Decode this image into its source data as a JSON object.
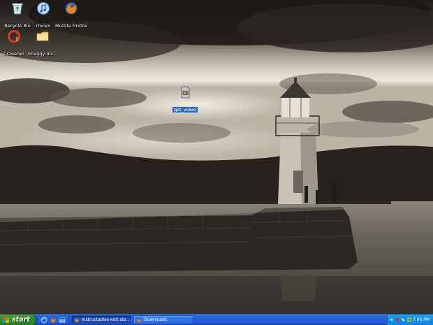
{
  "desktop": {
    "icons": [
      {
        "label": "Recycle Bin"
      },
      {
        "label": "iTunes"
      },
      {
        "label": "Mozilla Firefox"
      },
      {
        "label": "CCleaner"
      },
      {
        "label": "Shaggy-Ins..."
      },
      {
        "label": "get_video"
      }
    ],
    "selected_icon": "get_video"
  },
  "taskbar": {
    "start_label": "start",
    "quick_launch": [
      "ie-icon",
      "firefox-icon",
      "show-desktop-icon"
    ],
    "buttons": [
      {
        "label": "Instructables edit ste...",
        "icon": "firefox-icon",
        "active": true
      },
      {
        "label": "Downloads",
        "icon": "firefox-icon",
        "active": false
      }
    ],
    "tray": {
      "icons": [
        "speaker-icon",
        "security-icon",
        "network-icon",
        "itunes-helper-icon"
      ],
      "clock": "7:06 PM"
    }
  },
  "colors": {
    "taskbar_blue": "#245edb",
    "start_green": "#2f8a2d",
    "tray_blue": "#1490e9",
    "selection_blue": "#316ac5"
  }
}
